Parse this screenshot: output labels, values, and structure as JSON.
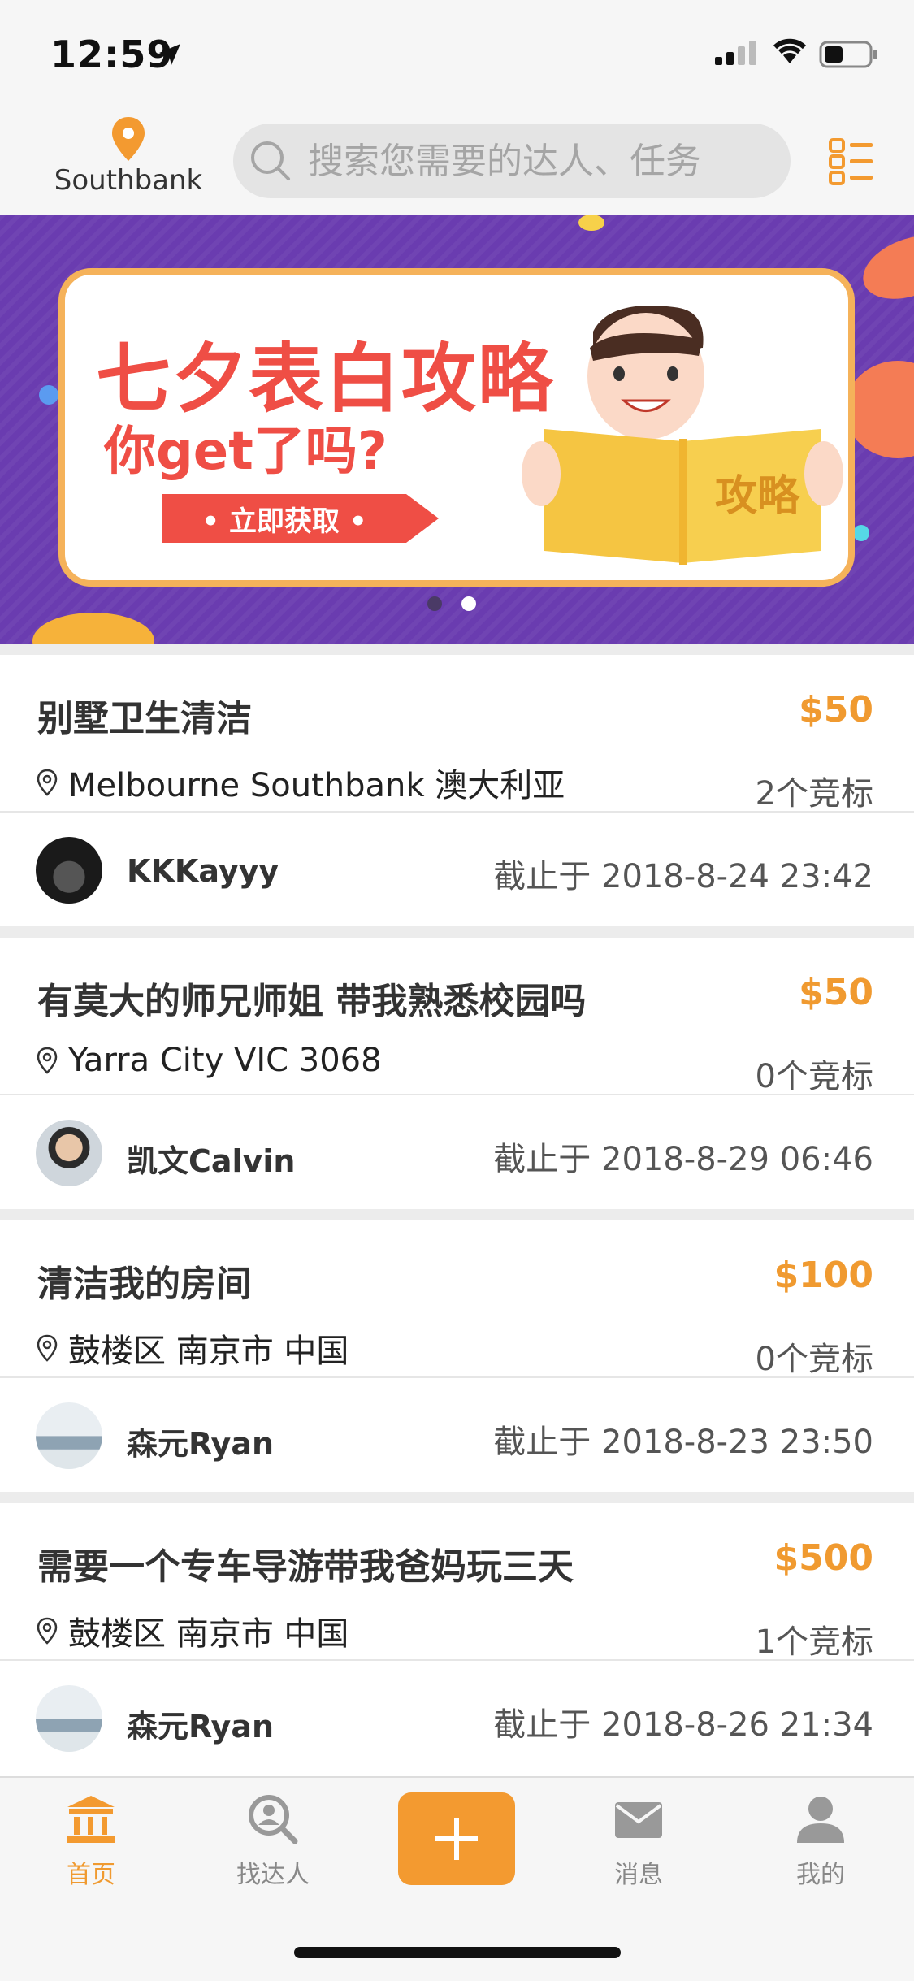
{
  "status": {
    "time": "12:59"
  },
  "header": {
    "location_label": "Southbank",
    "search_placeholder": "搜索您需要的达人、任务"
  },
  "banner": {
    "title": "七夕表白攻略",
    "subtitle": "你get了吗?",
    "button_label": "• 立即获取 •",
    "book_label": "攻略"
  },
  "tasks": [
    {
      "title": "别墅卫生清洁",
      "price": "$50",
      "location": "Melbourne Southbank 澳大利亚",
      "bids": "2个竞标",
      "user": "KKKayyy",
      "deadline": "截止于 2018-8-24 23:42"
    },
    {
      "title": "有莫大的师兄师姐 带我熟悉校园吗",
      "price": "$50",
      "location": "Yarra City VIC 3068",
      "bids": "0个竞标",
      "user": "凯文Calvin",
      "deadline": "截止于 2018-8-29 06:46"
    },
    {
      "title": "清洁我的房间",
      "price": "$100",
      "location": "鼓楼区 南京市 中国",
      "bids": "0个竞标",
      "user": "森元Ryan",
      "deadline": "截止于 2018-8-23 23:50"
    },
    {
      "title": "需要一个专车导游带我爸妈玩三天",
      "price": "$500",
      "location": "鼓楼区 南京市 中国",
      "bids": "1个竞标",
      "user": "森元Ryan",
      "deadline": "截止于 2018-8-26 21:34"
    }
  ],
  "tabs": [
    {
      "label": "首页",
      "icon": "home-icon"
    },
    {
      "label": "找达人",
      "icon": "search-person-icon"
    },
    {
      "label": "",
      "icon": "plus-icon"
    },
    {
      "label": "消息",
      "icon": "mail-icon"
    },
    {
      "label": "我的",
      "icon": "user-icon"
    }
  ],
  "colors": {
    "accent": "#f09a30",
    "banner_bg": "#6a3cb0",
    "banner_red": "#ef4e45"
  }
}
